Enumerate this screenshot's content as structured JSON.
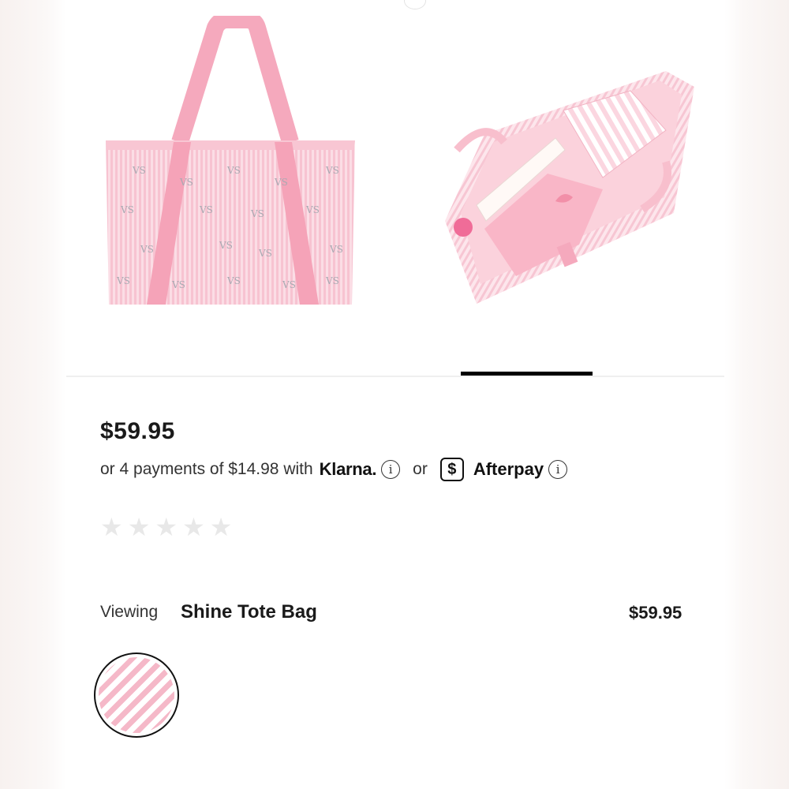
{
  "product": {
    "price": "$59.95",
    "payments": {
      "text": "or 4 payments of $14.98 with",
      "klarna": "Klarna.",
      "or": "or",
      "afterpay_badge": "$",
      "afterpay": "Afterpay",
      "info_glyph": "i"
    },
    "rating": {
      "stars_total": 5,
      "stars_filled": 0,
      "star_glyph": "★"
    },
    "viewing_label": "Viewing",
    "name": "Shine Tote Bag",
    "variant_price": "$59.95"
  },
  "colors": {
    "pink": "#f7bccb",
    "pink_light": "#fde3ea",
    "indicator": "#000000"
  },
  "icons": [
    "info-icon",
    "afterpay-dollar-icon",
    "star-icon"
  ]
}
